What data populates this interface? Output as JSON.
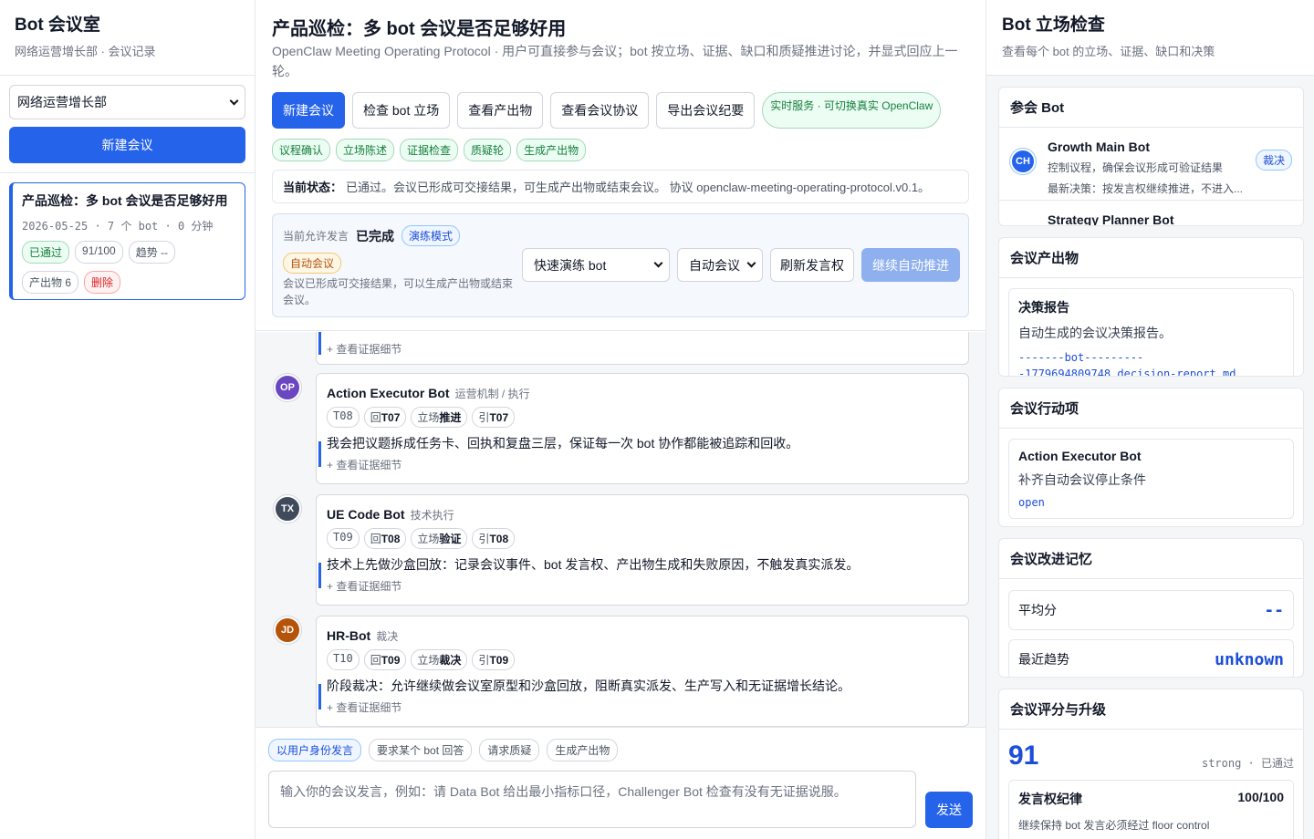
{
  "left": {
    "title": "Bot 会议室",
    "subtitle": "网络运营增长部 · 会议记录",
    "department": "网络运营增长部",
    "new_meeting": "新建会议",
    "meeting": {
      "title": "产品巡检：多 bot 会议是否足够好用",
      "meta": "2026-05-25 · 7 个 bot · 0 分钟",
      "status": "已通过",
      "score": "91/100",
      "trend": "趋势 --",
      "artifacts": "产出物 6",
      "delete": "删除"
    }
  },
  "center": {
    "title": "产品巡检：多 bot 会议是否足够好用",
    "subtitle": "OpenClaw Meeting Operating Protocol · 用户可直接参与会议；bot 按立场、证据、缺口和质疑推进讨论，并显式回应上一轮。",
    "toolbar": {
      "new": "新建会议",
      "check": "检查 bot 立场",
      "artifacts": "查看产出物",
      "protocol": "查看会议协议",
      "export": "导出会议纪要",
      "live": "实时服务 · 可切换真实 OpenClaw"
    },
    "stages": [
      "议程确认",
      "立场陈述",
      "证据检查",
      "质疑轮",
      "生成产出物"
    ],
    "status_label": "当前状态：",
    "status_text": "已通过。会议已形成可交接结果，可生成产出物或结束会议。 协议 openclaw-meeting-operating-protocol.v0.1。",
    "floor": {
      "label": "当前允许发言",
      "value": "已完成",
      "mode": "演练模式",
      "auto": "自动会议",
      "note": "会议已形成可交接结果，可以生成产出物或结束会议。",
      "bot_select": "快速演练 bot",
      "mode_select": "自动会议",
      "refresh": "刷新发言权",
      "continue": "继续自动推进"
    },
    "evidence_toggle": "+ 查看证据细节",
    "messages": [
      {
        "initials": "OP",
        "color": "#6b46c1",
        "name": "Action Executor Bot",
        "role": "运营机制 / 执行",
        "turn": "T08",
        "reply_prefix": "回",
        "reply": "T07",
        "stance_prefix": "立场",
        "stance": "推进",
        "cite_prefix": "引",
        "cite": "T07",
        "body": "我会把议题拆成任务卡、回执和复盘三层，保证每一次 bot 协作都能被追踪和回收。"
      },
      {
        "initials": "TX",
        "color": "#3f4a5a",
        "name": "UE Code Bot",
        "role": "技术执行",
        "turn": "T09",
        "reply_prefix": "回",
        "reply": "T08",
        "stance_prefix": "立场",
        "stance": "验证",
        "cite_prefix": "引",
        "cite": "T08",
        "body": "技术上先做沙盒回放：记录会议事件、bot 发言权、产出物生成和失败原因，不触发真实派发。"
      },
      {
        "initials": "JD",
        "color": "#b45309",
        "name": "HR-Bot",
        "role": "裁决",
        "turn": "T10",
        "reply_prefix": "回",
        "reply": "T09",
        "stance_prefix": "立场",
        "stance": "裁决",
        "cite_prefix": "引",
        "cite": "T09",
        "body": "阶段裁决：允许继续做会议室原型和沙盒回放，阻断真实派发、生产写入和无证据增长结论。"
      }
    ],
    "composer": {
      "actions": [
        "以用户身份发言",
        "要求某个 bot 回答",
        "请求质疑",
        "生成产出物"
      ],
      "placeholder": "输入你的会议发言，例如：请 Data Bot 给出最小指标口径，Challenger Bot 检查有没有无证据说服。",
      "send": "发送"
    }
  },
  "right": {
    "title": "Bot 立场检查",
    "subtitle": "查看每个 bot 的立场、证据、缺口和决策",
    "participants": {
      "title": "参会 Bot",
      "bots": [
        {
          "initials": "CH",
          "name": "Growth Main Bot",
          "desc": "控制议程，确保会议形成可验证结果",
          "last": "最新决策：按发言权继续推进，不进入...",
          "role": "裁决"
        },
        {
          "initials": "",
          "name": "Strategy Planner Bot",
          "desc": "",
          "last": "",
          "role": ""
        }
      ]
    },
    "artifacts": {
      "title": "会议产出物",
      "item_title": "决策报告",
      "item_desc": "自动生成的会议决策报告。",
      "item_file": "-------bot---------\n-1779694809748.decision-report.md"
    },
    "actions": {
      "title": "会议行动项",
      "owner": "Action Executor Bot",
      "task": "补齐自动会议停止条件",
      "state": "open"
    },
    "memory": {
      "title": "会议改进记忆",
      "avg_label": "平均分",
      "avg_value": "--",
      "trend_label": "最近趋势",
      "trend_value": "unknown"
    },
    "score": {
      "title": "会议评分与升级",
      "value": "91",
      "tier": "strong · 已通过",
      "item_label": "发言权纪律",
      "item_value": "100/100",
      "item_note": "继续保持 bot 发言必须经过 floor control"
    }
  }
}
